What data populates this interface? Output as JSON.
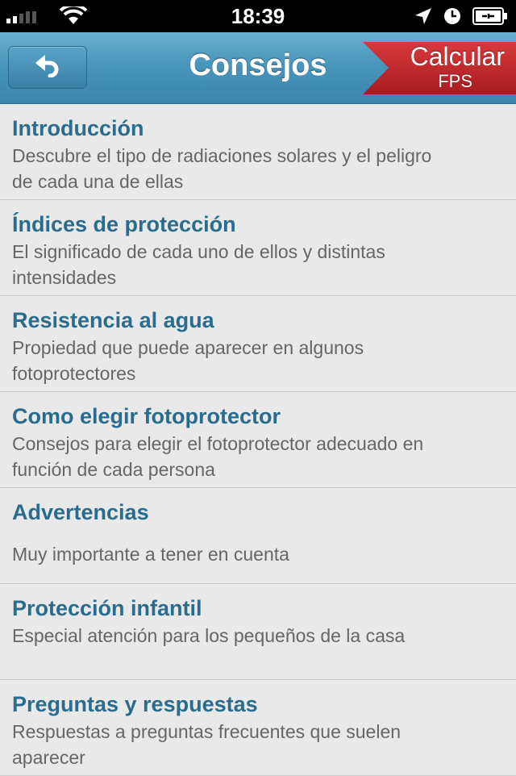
{
  "status_bar": {
    "time": "18:39",
    "icons": [
      "signal-icon",
      "wifi-icon",
      "location-icon",
      "clock-icon",
      "battery-icon"
    ]
  },
  "nav": {
    "title": "Consejos",
    "back_icon": "back-arrow-icon",
    "calc_line1": "Calcular",
    "calc_line2": "FPS"
  },
  "colors": {
    "nav_blue": "#4a95bc",
    "title_blue": "#2a6c8e",
    "calc_red": "#c2262b",
    "background": "#e9e9e9"
  },
  "items": [
    {
      "title": "Introducción",
      "desc": "Descubre el tipo de radiaciones solares y el peligro de cada una de ellas"
    },
    {
      "title": "Índices de protección",
      "desc": "El significado de cada uno de ellos y distintas intensidades"
    },
    {
      "title": "Resistencia al agua",
      "desc": "Propiedad que puede aparecer en algunos fotoprotectores"
    },
    {
      "title": "Como elegir fotoprotector",
      "desc": "Consejos para elegir el fotoprotector adecuado en función de cada persona"
    },
    {
      "title": "Advertencias",
      "desc": "Muy importante a tener en cuenta"
    },
    {
      "title": "Protección infantil",
      "desc": "Especial atención para los pequeños de la casa"
    },
    {
      "title": "Preguntas y respuestas",
      "desc": "Respuestas a preguntas frecuentes que suelen aparecer"
    }
  ]
}
